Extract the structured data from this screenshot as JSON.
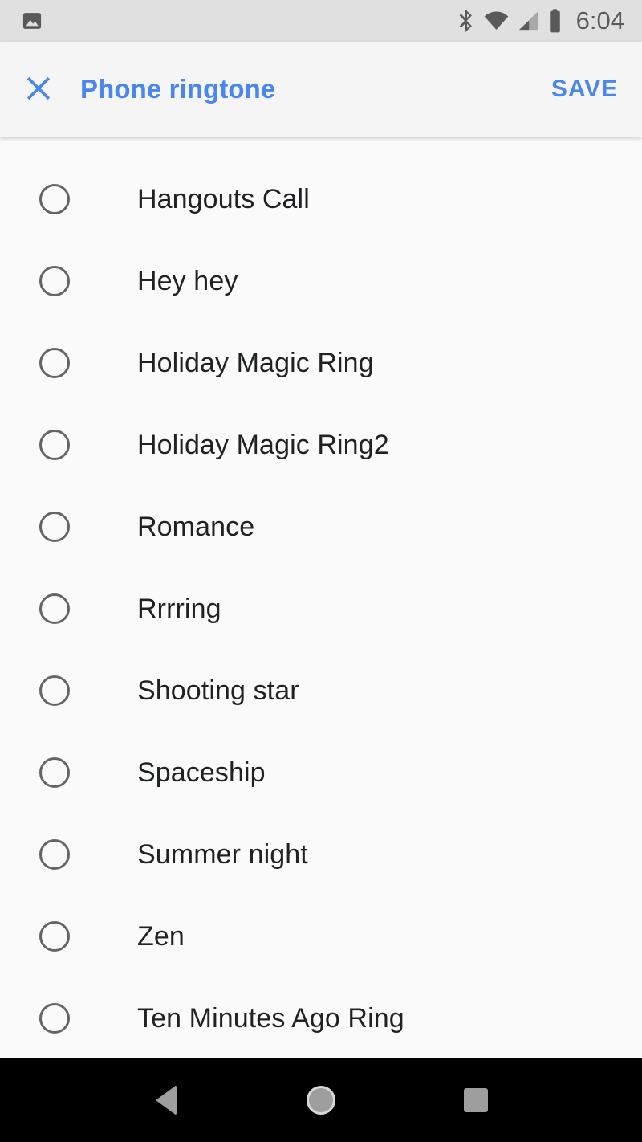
{
  "status_bar": {
    "notification_icon": "image-icon",
    "icons": [
      "bluetooth-icon",
      "wifi-icon",
      "cell-signal-icon",
      "battery-icon"
    ],
    "time": "6:04",
    "background_color": "#e0e0e0",
    "icon_color": "#5a5a5a"
  },
  "header": {
    "close_icon": "close-icon",
    "title": "Phone ringtone",
    "save_label": "SAVE",
    "accent_color": "#4a86ee",
    "background_color": "#f5f5f5"
  },
  "list": {
    "background_color": "#fafafa",
    "text_color": "#1f2123",
    "radio_color": "#636567",
    "selected_index": -1,
    "items": [
      {
        "label": "Hangouts Call",
        "selected": false
      },
      {
        "label": "Hey hey",
        "selected": false
      },
      {
        "label": "Holiday Magic Ring",
        "selected": false
      },
      {
        "label": "Holiday Magic Ring2",
        "selected": false
      },
      {
        "label": "Romance",
        "selected": false
      },
      {
        "label": "Rrrring",
        "selected": false
      },
      {
        "label": "Shooting star",
        "selected": false
      },
      {
        "label": "Spaceship",
        "selected": false
      },
      {
        "label": "Summer night",
        "selected": false
      },
      {
        "label": "Zen",
        "selected": false
      },
      {
        "label": "Ten Minutes Ago Ring",
        "selected": false
      }
    ]
  },
  "nav_bar": {
    "background_color": "#000000",
    "icon_color": "#9e9e9e",
    "buttons": [
      {
        "name": "back-icon",
        "label": "Back"
      },
      {
        "name": "home-icon",
        "label": "Home"
      },
      {
        "name": "recents-icon",
        "label": "Recents"
      }
    ]
  }
}
